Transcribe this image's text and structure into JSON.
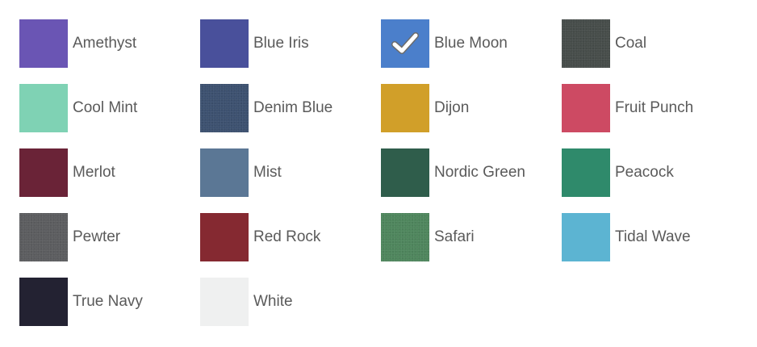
{
  "selected": "Blue Moon",
  "swatches": [
    {
      "name": "Amethyst",
      "color": "#6a55b4",
      "selected": false,
      "textured": false
    },
    {
      "name": "Blue Iris",
      "color": "#49509b",
      "selected": false,
      "textured": false
    },
    {
      "name": "Blue Moon",
      "color": "#4b7fcb",
      "selected": true,
      "textured": false
    },
    {
      "name": "Coal",
      "color": "#474d4a",
      "selected": false,
      "textured": true
    },
    {
      "name": "Cool Mint",
      "color": "#7fd2b4",
      "selected": false,
      "textured": false
    },
    {
      "name": "Denim Blue",
      "color": "#3d5170",
      "selected": false,
      "textured": true
    },
    {
      "name": "Dijon",
      "color": "#d19f29",
      "selected": false,
      "textured": false
    },
    {
      "name": "Fruit Punch",
      "color": "#cd4a63",
      "selected": false,
      "textured": false
    },
    {
      "name": "Merlot",
      "color": "#6a2337",
      "selected": false,
      "textured": false
    },
    {
      "name": "Mist",
      "color": "#5b7795",
      "selected": false,
      "textured": false
    },
    {
      "name": "Nordic Green",
      "color": "#2f5d4b",
      "selected": false,
      "textured": false
    },
    {
      "name": "Peacock",
      "color": "#2f8a6b",
      "selected": false,
      "textured": false
    },
    {
      "name": "Pewter",
      "color": "#5c5d60",
      "selected": false,
      "textured": true
    },
    {
      "name": "Red Rock",
      "color": "#852931",
      "selected": false,
      "textured": false
    },
    {
      "name": "Safari",
      "color": "#4f865d",
      "selected": false,
      "textured": true
    },
    {
      "name": "Tidal Wave",
      "color": "#5cb4d2",
      "selected": false,
      "textured": false
    },
    {
      "name": "True Navy",
      "color": "#232232",
      "selected": false,
      "textured": false
    },
    {
      "name": "White",
      "color": "#eff0f0",
      "selected": false,
      "textured": false
    }
  ],
  "icons": {
    "selected_marker": "checkmark-icon"
  }
}
